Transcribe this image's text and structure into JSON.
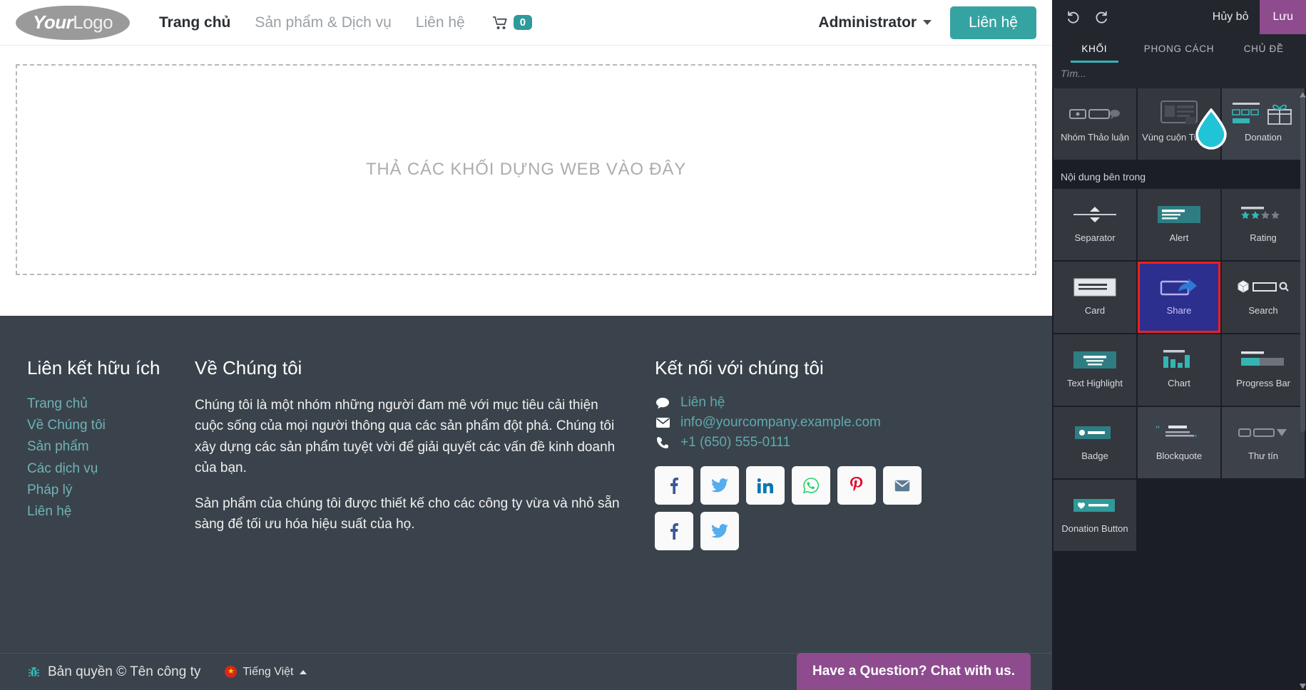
{
  "site": {
    "logo": {
      "bold": "Your",
      "light": "Logo"
    },
    "nav": [
      {
        "label": "Trang chủ",
        "active": true
      },
      {
        "label": "Sản phẩm & Dịch vụ",
        "active": false
      },
      {
        "label": "Liên hệ",
        "active": false
      }
    ],
    "cart_count": "0",
    "account_label": "Administrator",
    "contact_button": "Liên hệ",
    "dropzone_label": "THẢ CÁC KHỐI DỰNG WEB VÀO ĐÂY"
  },
  "footer": {
    "links_title": "Liên kết hữu ích",
    "links": [
      "Trang chủ",
      "Về Chúng tôi",
      "Sản phẩm",
      "Các dịch vụ",
      "Pháp lý",
      "Liên hệ"
    ],
    "about_title": "Về Chúng tôi",
    "about_p1": "Chúng tôi là một nhóm những người đam mê với mục tiêu cải thiện cuộc sống của mọi người thông qua các sản phẩm đột phá. Chúng tôi xây dựng các sản phẩm tuyệt vời để giải quyết các vấn đề kinh doanh của bạn.",
    "about_p2": "Sản phẩm của chúng tôi được thiết kế cho các công ty vừa và nhỏ sẵn sàng để tối ưu hóa hiệu suất của họ.",
    "connect_title": "Kết nối với chúng tôi",
    "contacts": [
      {
        "icon": "chat-icon",
        "text": "Liên hệ"
      },
      {
        "icon": "envelope-icon",
        "text": "info@yourcompany.example.com"
      },
      {
        "icon": "phone-icon",
        "text": "+1 (650) 555-0111"
      }
    ],
    "socials": [
      "facebook-icon",
      "twitter-icon",
      "linkedin-icon",
      "whatsapp-icon",
      "pinterest-icon",
      "email-icon",
      "facebook-icon",
      "twitter-icon"
    ],
    "copyright": "Bản quyền © Tên công ty",
    "language": "Tiếng Việt",
    "chat_widget": "Have a Question? Chat with us."
  },
  "panel": {
    "cancel_label": "Hủy bỏ",
    "save_label": "Lưu",
    "tabs": [
      {
        "label": "KHỐI",
        "active": true
      },
      {
        "label": "PHONG CÁCH",
        "active": false
      },
      {
        "label": "CHỦ ĐỀ",
        "active": false
      }
    ],
    "search_placeholder": "Tìm...",
    "row_top": [
      {
        "label": "Nhóm Thảo luận",
        "icon": "discussion-group-icon",
        "state": "normal"
      },
      {
        "label": "Vùng cuộn Twitter",
        "icon": "twitter-scroll-icon",
        "state": "normal"
      },
      {
        "label": "Donation",
        "icon": "gift-icon",
        "state": "hover"
      }
    ],
    "section_title": "Nội dung bên trong",
    "tiles": [
      {
        "label": "Separator",
        "icon": "separator-icon",
        "state": "normal"
      },
      {
        "label": "Alert",
        "icon": "alert-icon",
        "state": "normal"
      },
      {
        "label": "Rating",
        "icon": "rating-stars-icon",
        "state": "normal"
      },
      {
        "label": "Card",
        "icon": "card-icon",
        "state": "normal"
      },
      {
        "label": "Share",
        "icon": "share-icon",
        "state": "selected"
      },
      {
        "label": "Search",
        "icon": "search-box-icon",
        "state": "normal"
      },
      {
        "label": "Text Highlight",
        "icon": "text-highlight-icon",
        "state": "normal"
      },
      {
        "label": "Chart",
        "icon": "bar-chart-icon",
        "state": "normal"
      },
      {
        "label": "Progress Bar",
        "icon": "progress-bar-icon",
        "state": "normal"
      },
      {
        "label": "Badge",
        "icon": "badge-icon",
        "state": "normal"
      },
      {
        "label": "Blockquote",
        "icon": "blockquote-icon",
        "state": "hover"
      },
      {
        "label": "Thư tín",
        "icon": "newsletter-icon",
        "state": "hover"
      },
      {
        "label": "Donation Button",
        "icon": "donation-button-icon",
        "state": "normal"
      }
    ],
    "colors": {
      "accent": "#35b4b4",
      "save": "#8e4b8e",
      "selected_bg": "#2d2f8f",
      "selected_border": "#ef2020",
      "panel_bg": "#1b1e26",
      "tile_bg": "#34373e"
    }
  }
}
